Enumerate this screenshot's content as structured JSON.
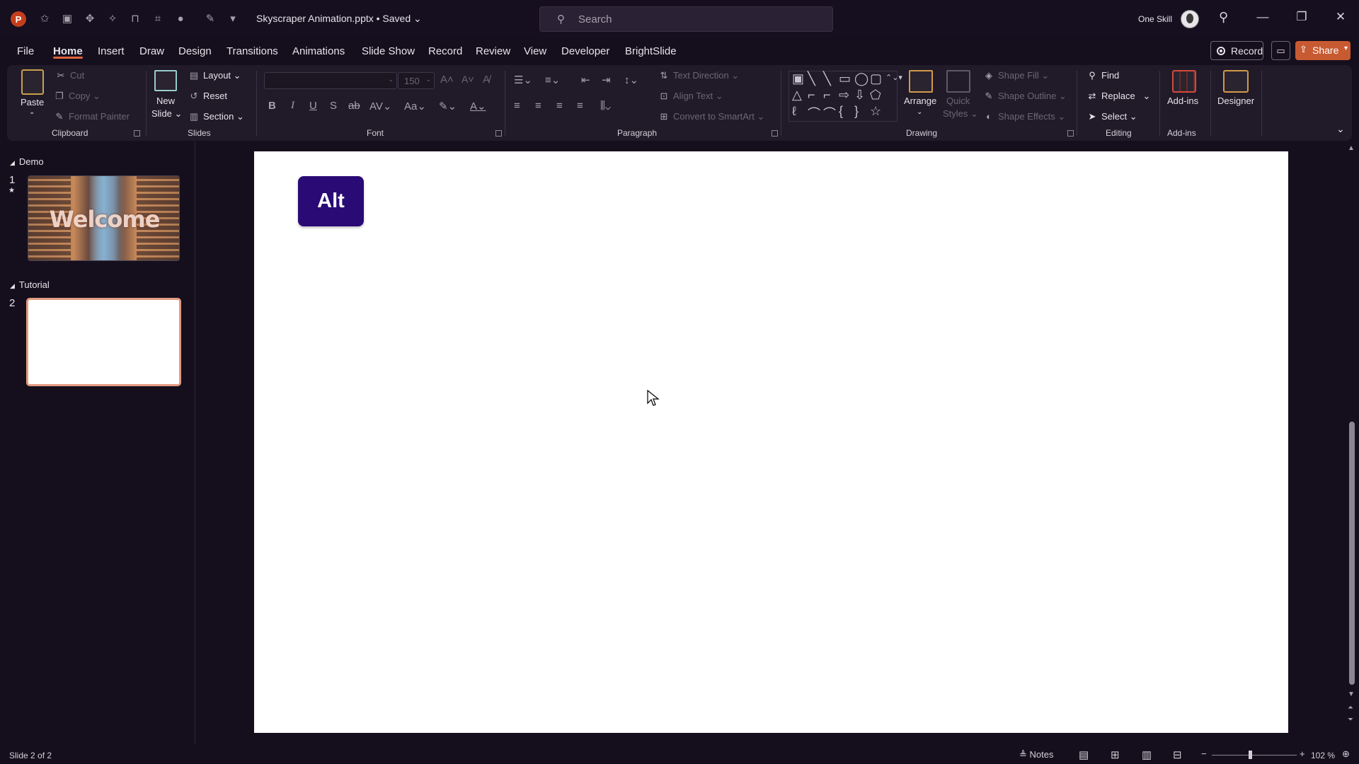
{
  "titlebar": {
    "app_logo": "P",
    "doc_title": "Skyscraper Animation.pptx • Saved ⌄",
    "search_placeholder": "Search",
    "user_name": "One Skill"
  },
  "menu": {
    "tabs": [
      "File",
      "Home",
      "Insert",
      "Draw",
      "Design",
      "Transitions",
      "Animations",
      "Slide Show",
      "Record",
      "Review",
      "View",
      "Developer",
      "BrightSlide"
    ],
    "active_tab": "Home",
    "record_label": "Record",
    "share_label": "Share"
  },
  "ribbon": {
    "clipboard": {
      "paste": "Paste",
      "cut": "Cut",
      "copy": "Copy",
      "format_painter": "Format Painter",
      "label": "Clipboard"
    },
    "slides": {
      "new_slide": "New",
      "new_slide_2": "Slide",
      "layout": "Layout",
      "reset": "Reset",
      "section": "Section",
      "label": "Slides"
    },
    "font": {
      "font_name": "",
      "font_size": "150",
      "label": "Font"
    },
    "paragraph": {
      "text_direction": "Text Direction",
      "align_text": "Align Text",
      "convert_smartart": "Convert to SmartArt",
      "label": "Paragraph"
    },
    "drawing": {
      "arrange": "Arrange",
      "quick_styles": "Quick",
      "quick_styles_2": "Styles",
      "shape_fill": "Shape Fill",
      "shape_outline": "Shape Outline",
      "shape_effects": "Shape Effects",
      "label": "Drawing"
    },
    "editing": {
      "find": "Find",
      "replace": "Replace",
      "select": "Select",
      "label": "Editing"
    },
    "addins": {
      "addins": "Add-ins",
      "label": "Add-ins"
    },
    "designer": {
      "designer": "Designer"
    }
  },
  "slide_panel": {
    "sections": [
      {
        "name": "Demo",
        "slides": [
          {
            "number": "1",
            "thumb_text": "Welcome"
          }
        ]
      },
      {
        "name": "Tutorial",
        "slides": [
          {
            "number": "2"
          }
        ]
      }
    ]
  },
  "slide": {
    "alt_button": "Alt"
  },
  "status": {
    "slide_count": "Slide 2 of 2",
    "notes": "Notes",
    "zoom": "102 %"
  },
  "colors": {
    "accent": "#e0643c",
    "share": "#c85a32",
    "alt_button": "#2a0a75",
    "background": "#150f1d"
  }
}
